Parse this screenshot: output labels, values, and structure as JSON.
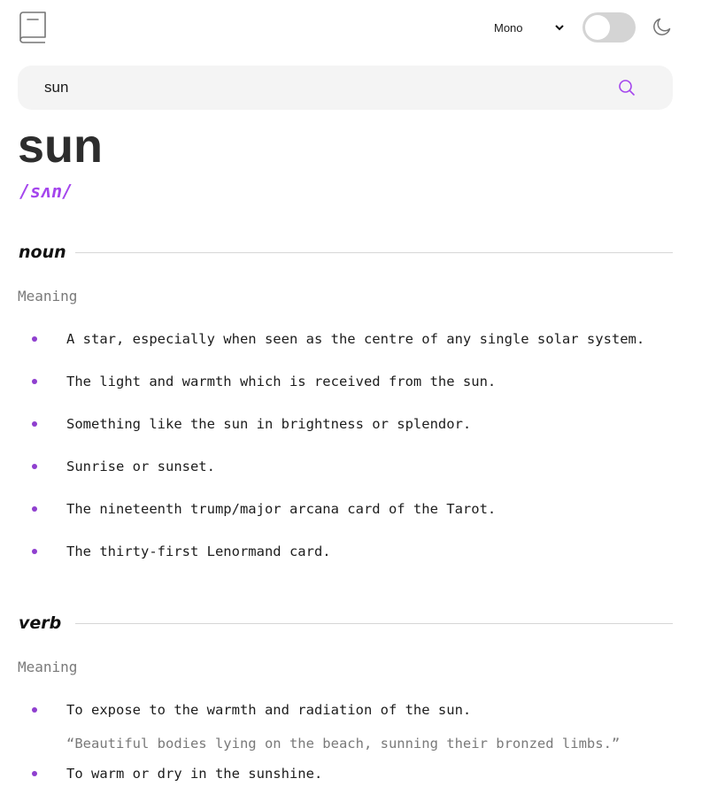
{
  "header": {
    "logo_icon": "book-icon",
    "font_select": {
      "selected": "Mono"
    },
    "theme_toggle": {
      "state": "off"
    },
    "theme_icon": "moon-icon"
  },
  "search": {
    "value": "sun",
    "icon": "search-icon",
    "accent_color": "#a445ed"
  },
  "entry": {
    "word": "sun",
    "phonetic": "/sʌn/",
    "meanings": [
      {
        "part_of_speech": "noun",
        "heading": "Meaning",
        "definitions": [
          "A star, especially when seen as the centre of any single solar system.",
          "The light and warmth which is received from the sun.",
          "Something like the sun in brightness or splendor.",
          "Sunrise or sunset.",
          "The nineteenth trump/major arcana card of the Tarot.",
          "The thirty-first Lenormand card."
        ]
      },
      {
        "part_of_speech": "verb",
        "heading": "Meaning",
        "definitions": [
          "To expose to the warmth and radiation of the sun.",
          "To warm or dry in the sunshine."
        ],
        "example": "“Beautiful bodies lying on the beach, sunning their bronzed limbs.”"
      }
    ]
  }
}
